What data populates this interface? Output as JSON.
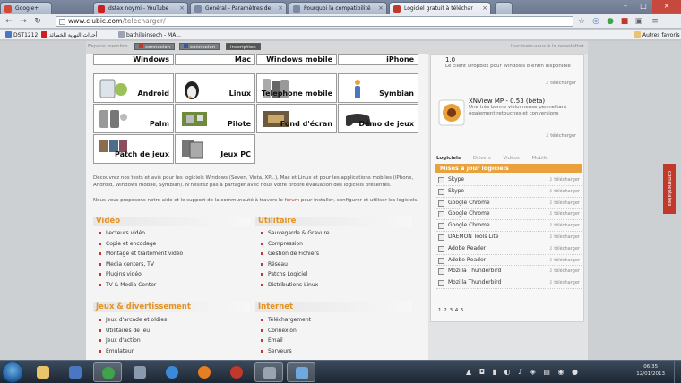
{
  "browser": {
    "tabs": [
      {
        "title": "Google+",
        "color": "#d34836"
      },
      {
        "title": "dstax noymi - YouTube",
        "color": "#cc1f1f"
      },
      {
        "title": "Général - Paramètres de",
        "color": "#7a8aa3"
      },
      {
        "title": "Pourquoi la compatibilité",
        "color": "#7a8aa3"
      },
      {
        "title": "Logiciel gratuit à téléchar",
        "color": "#c0392b"
      }
    ],
    "url_host": "www.clubic.com",
    "url_path": "/telecharger/",
    "bookmarks": [
      {
        "label": "DST1212",
        "color": "#4a76c2"
      },
      {
        "label": "أحداث النهاية الخطائد",
        "color": "#cc1f1f"
      },
      {
        "label": "bathileinsech - MA...",
        "color": "#9aa3b0"
      }
    ],
    "other_bookmarks": "Autres favoris"
  },
  "site": {
    "espace_membre": "Espace membre",
    "buttons": [
      "connexion",
      "connexion",
      "inscription"
    ],
    "forum_link": "Inscrivez-vous à la newsletter"
  },
  "categories": {
    "row0": [
      "Windows",
      "Mac",
      "Windows mobile",
      "iPhone"
    ],
    "row1": [
      "Android",
      "Linux",
      "Telephone mobile",
      "Symbian"
    ],
    "row2": [
      "Palm",
      "Pilote",
      "Fond d'écran",
      "Démo de jeux"
    ],
    "row3": [
      "Patch de jeux",
      "Jeux PC"
    ]
  },
  "intro": {
    "para1": "Découvrez nos tests et avis pour les logiciels Windows (Seven, Vista, XP...), Mac et Linux et pour les applications mobiles (iPhone, Android, Windows mobile, Symbian). N'hésitez pas à partager avec nous votre propre évaluation des logiciels présentés.",
    "para2_before": "Nous vous proposons notre aide et le support de la communauté à travers le ",
    "para2_link": "forum",
    "para2_after": " pour installer, configurer et utiliser les logiciels."
  },
  "sections": {
    "video": {
      "title": "Vidéo",
      "items": [
        "Lecteurs vidéo",
        "Copie et encodage",
        "Montage et traitement vidéo",
        "Media centers, TV",
        "Plugins vidéo",
        "TV & Media Center"
      ]
    },
    "utilitaire": {
      "title": "Utilitaire",
      "items": [
        "Sauvegarde & Gravure",
        "Compression",
        "Gestion de Fichiers",
        "Réseau",
        "Patchs Logiciel",
        "Distributions Linux"
      ]
    },
    "jeux": {
      "title": "Jeux & divertissement",
      "items": [
        "Jeux d'arcade et oldies",
        "Utilitaires de jeu",
        "Jeux d'action",
        "Emulateur"
      ]
    },
    "internet": {
      "title": "Internet",
      "items": [
        "Téléchargement",
        "Connexion",
        "Email",
        "Serveurs"
      ]
    }
  },
  "sidebar": {
    "item1": {
      "version": "1.0",
      "desc": "Le client DropBox pour Windows 8 enfin disponible",
      "dl": "télécharger"
    },
    "item2": {
      "version": "XNView MP - 0.53 (bêta)",
      "desc": "Une très bonne visionneuse permettant également retouches et conversions",
      "dl": "télécharger"
    },
    "tabs": [
      "Logiciels",
      "Drivers",
      "Vidéos",
      "Mobile"
    ],
    "updates_title": "Mises à jour logiciels",
    "updates": [
      "Skype",
      "Skype",
      "Google Chrome",
      "Google Chrome",
      "Google Chrome",
      "DAEMON Tools Lite",
      "Adobe Reader",
      "Adobe Reader",
      "Mozilla Thunderbird",
      "Mozilla Thunderbird"
    ],
    "dl_label": "télécharger",
    "pager": "1 2 3 4 5"
  },
  "comments_tab": "commentaires",
  "taskbar": {
    "time": "06:35",
    "date": "12/01/2013",
    "apps": [
      {
        "name": "explorer-folder-icon",
        "color": "#e9c46a"
      },
      {
        "name": "media-player-icon",
        "color": "#4a76c2"
      },
      {
        "name": "chrome-icon",
        "color": "#3fa34d"
      },
      {
        "name": "tool-icon",
        "color": "#8a99ad"
      },
      {
        "name": "internet-explorer-icon",
        "color": "#3b8ad9"
      },
      {
        "name": "firefox-icon",
        "color": "#e67e22"
      },
      {
        "name": "opera-icon",
        "color": "#c0392b"
      },
      {
        "name": "window-icon",
        "color": "#9aa3b0"
      },
      {
        "name": "monitor-icon",
        "color": "#6fa8dc"
      }
    ]
  }
}
